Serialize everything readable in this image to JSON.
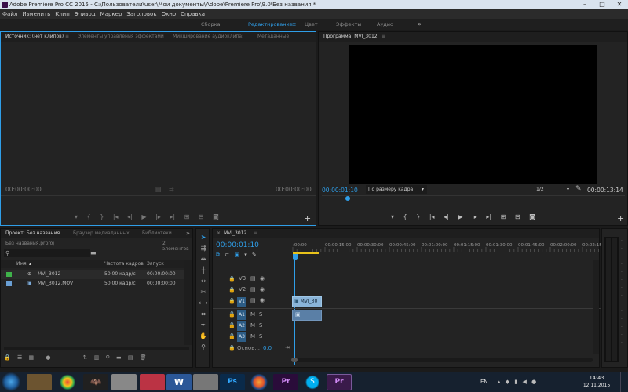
{
  "window": {
    "title": "Adobe Premiere Pro CC 2015 - C:\\Пользователи\\user\\Мои документы\\Adobe\\Premiere Pro\\9.0\\Без названия *"
  },
  "menu": [
    "Файл",
    "Изменить",
    "Клип",
    "Эпизод",
    "Маркер",
    "Заголовок",
    "Окно",
    "Справка"
  ],
  "workspaces": {
    "items": [
      "Сборка",
      "Редактирование",
      "Цвет",
      "Эффекты",
      "Аудио"
    ],
    "active": "Редактирование",
    "more": "»",
    "active_menu": "≡"
  },
  "source_panel": {
    "tabs": [
      "Источник: (нет клипов)",
      "Элементы управления эффектами",
      "Микширование аудиоклипа:",
      "Метаданные"
    ],
    "tab_menu": "≡",
    "timecode_left": "00:00:00:00",
    "timecode_right": "00:00:00:00"
  },
  "program_panel": {
    "tab": "Программа: MVI_3012",
    "tab_menu": "≡",
    "timecode_current": "00:00:01:10",
    "fit": "По размеру кадра",
    "resolution": "1/2",
    "timecode_duration": "00:00:13:14"
  },
  "project_panel": {
    "tabs": [
      "Проект: Без названия",
      "Браузер медиаданных",
      "Библиотеки"
    ],
    "more": "»",
    "file": "Без названия.prproj",
    "count": "2 элементов",
    "columns": [
      "Имя",
      "Частота кадров",
      "Запуск медиаданн"
    ],
    "rows": [
      {
        "name": "MVI_3012",
        "fps": "50,00 кадр/с",
        "start": "00:00:00:00",
        "color": "#3fb24a"
      },
      {
        "name": "MVI_3012.MOV",
        "fps": "50,00 кадр/с",
        "start": "00:00:00:00",
        "color": "#6a9fd4"
      }
    ]
  },
  "timeline": {
    "tab": "MVI_3012",
    "tab_menu": "≡",
    "timecode": "00:00:01:10",
    "ruler": [
      ":00:00",
      "00:00:15:00",
      "00:00:30:00",
      "00:00:45:00",
      "00:01:00:00",
      "00:01:15:00",
      "00:01:30:00",
      "00:01:45:00",
      "00:02:00:00",
      "00:02:15:00"
    ],
    "video_tracks": [
      "V3",
      "V2",
      "V1"
    ],
    "audio_tracks": [
      "A1",
      "A2",
      "A3"
    ],
    "master_label": "Основ...",
    "master_value": "0,0",
    "clip_label": "MVI_30",
    "audio_labels": [
      "M",
      "S"
    ]
  },
  "taskbar": {
    "lang": "EN",
    "time": "14:43",
    "date": "12.11.2015"
  },
  "colors": {
    "accent": "#2f9ee8",
    "clip_video": "#8ab4d8",
    "clip_audio": "#5a7fa6",
    "track_active": "#2d5d86"
  }
}
